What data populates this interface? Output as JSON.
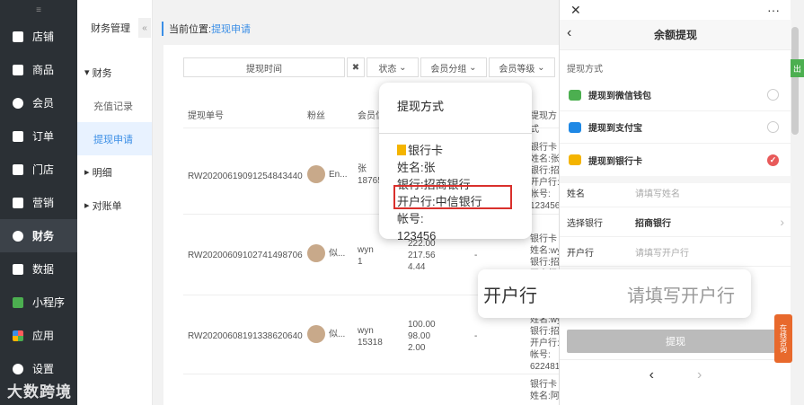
{
  "sidebar": {
    "toggle": "≡",
    "items": [
      {
        "label": "店铺",
        "icon": "store-icon"
      },
      {
        "label": "商品",
        "icon": "goods-icon"
      },
      {
        "label": "会员",
        "icon": "member-icon"
      },
      {
        "label": "订单",
        "icon": "order-icon"
      },
      {
        "label": "门店",
        "icon": "shop-icon"
      },
      {
        "label": "营销",
        "icon": "marketing-icon"
      },
      {
        "label": "财务",
        "icon": "finance-icon",
        "active": true
      },
      {
        "label": "数据",
        "icon": "data-icon"
      },
      {
        "label": "小程序",
        "icon": "miniprogram-icon"
      },
      {
        "label": "应用",
        "icon": "apps-icon"
      },
      {
        "label": "设置",
        "icon": "settings-icon"
      }
    ]
  },
  "subbar": {
    "title": "财务管理",
    "collapse": "«",
    "group1": "财务",
    "items": [
      "充值记录",
      "提现申请"
    ],
    "group2": "明细",
    "group3": "对账单"
  },
  "breadcrumb": {
    "prefix": "当前位置:",
    "current": "提现申请"
  },
  "filters": {
    "time": "提现时间",
    "clear": "✖",
    "status": "状态",
    "group": "会员分组",
    "level": "会员等级"
  },
  "table": {
    "headers": [
      "提现单号",
      "粉丝",
      "会员信",
      "提现方式"
    ],
    "rows": [
      {
        "id": "RW20200619091254843440",
        "fan": "En...",
        "member": "张\n18765",
        "amounts": "",
        "method": "银行卡\n姓名:张\n银行:招商\n开户行:\n帐号:\n123456"
      },
      {
        "id": "RW20200609102741498706",
        "fan": "似...",
        "member": "wyn\n1",
        "amounts": "222.00\n217.56\n4.44",
        "dash": "-",
        "method": "银行卡\n姓名:wy\n银行:招商\n开户行:\n帐号:"
      },
      {
        "id": "RW20200608191338620640",
        "fan": "似...",
        "member": "wyn\n15318",
        "amounts": "100.00\n98.00\n2.00",
        "dash": "-",
        "method": "姓名:wy\n银行:招商\n开户行:\n帐号:\n6224815"
      },
      {
        "id": "",
        "fan": "",
        "member": "",
        "amounts": "",
        "method": "银行卡\n姓名:阿联"
      }
    ]
  },
  "popover": {
    "title": "提现方式",
    "lines": [
      "银行卡",
      "姓名:张",
      "银行:招商银行",
      "开户行:中信银行",
      "帐号:",
      "123456"
    ]
  },
  "callout": {
    "label": "开户行",
    "placeholder": "请填写开户行"
  },
  "phone": {
    "close": "✕",
    "more": "···",
    "back": "‹",
    "title": "余额提现",
    "section": "提现方式",
    "options": [
      {
        "label": "提现到微信钱包",
        "icon": "wechat-icon",
        "color": "#4caf50",
        "selected": false
      },
      {
        "label": "提现到支付宝",
        "icon": "alipay-icon",
        "color": "#1e88e5",
        "selected": false
      },
      {
        "label": "提现到银行卡",
        "icon": "bankcard-icon",
        "color": "#f4b400",
        "selected": true
      }
    ],
    "fields": [
      {
        "label": "姓名",
        "value": "请填写姓名",
        "filled": false
      },
      {
        "label": "选择银行",
        "value": "招商银行",
        "filled": true,
        "arrow": "›"
      },
      {
        "label": "开户行",
        "value": "请填写开户行",
        "filled": false
      }
    ],
    "submit": "提现",
    "nav_back": "‹",
    "nav_forward": "›"
  },
  "side": {
    "green_tab": "出",
    "consult": "在线咨询"
  },
  "watermark": "大数跨境",
  "colors": {
    "accent": "#3a8ee6",
    "danger": "#e85a5a",
    "sidebar": "#2b3035",
    "consult": "#e8692c"
  }
}
